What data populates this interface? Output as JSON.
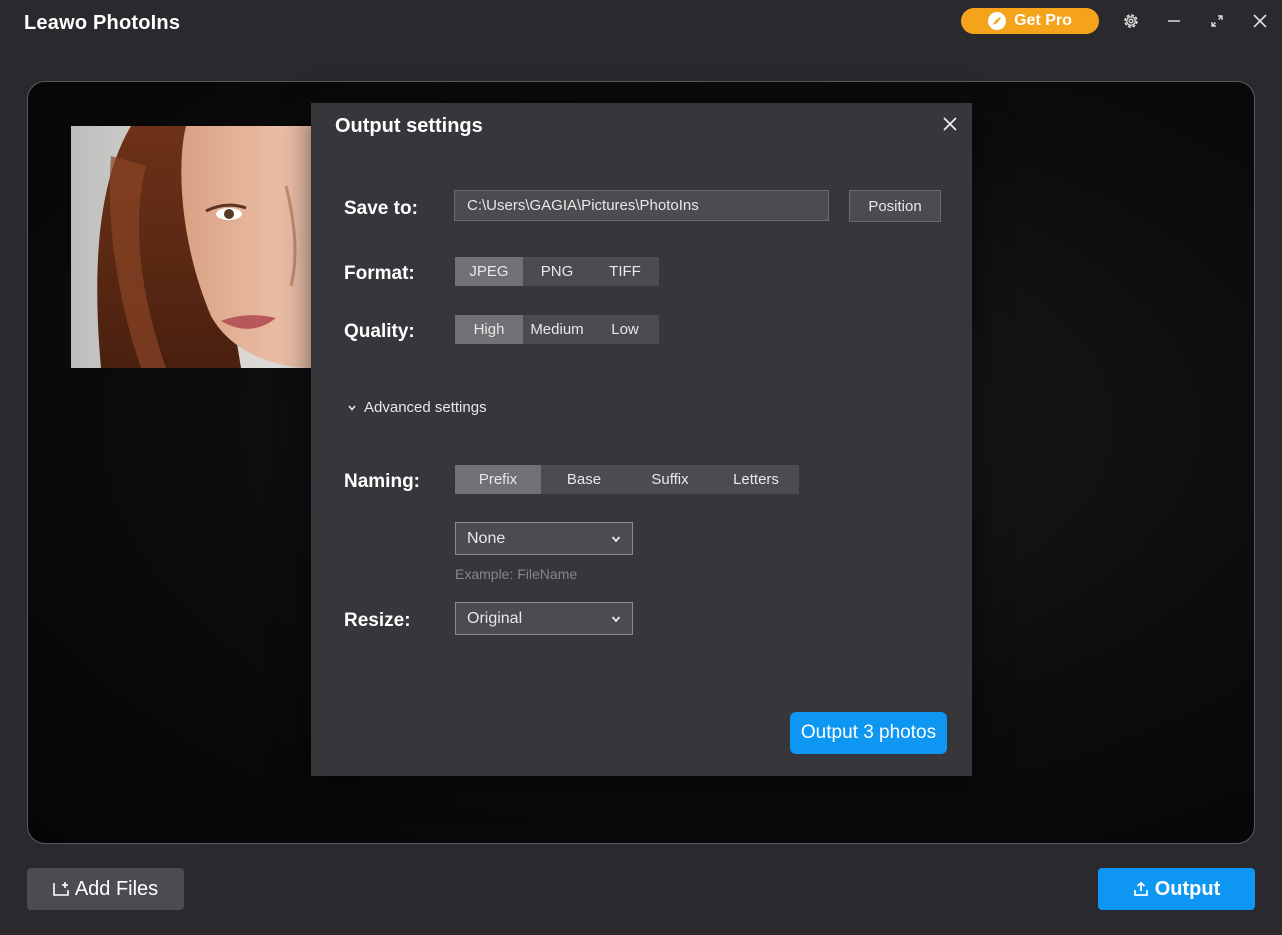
{
  "app": {
    "title": "Leawo PhotoIns",
    "get_pro_label": "Get Pro",
    "accent": "#0d96f2",
    "pro_color": "#f5a31a"
  },
  "window_controls": [
    "gear-icon",
    "minimize-icon",
    "maximize-icon",
    "close-icon"
  ],
  "modal": {
    "title": "Output settings",
    "save_to": {
      "label": "Save to:",
      "path": "C:\\Users\\GAGIA\\Pictures\\PhotoIns",
      "button": "Position"
    },
    "format": {
      "label": "Format:",
      "options": [
        "JPEG",
        "PNG",
        "TIFF"
      ],
      "selected": "JPEG"
    },
    "quality": {
      "label": "Quality:",
      "options": [
        "High",
        "Medium",
        "Low"
      ],
      "selected": "High"
    },
    "advanced_label": "Advanced settings",
    "naming": {
      "label": "Naming:",
      "options": [
        "Prefix",
        "Base",
        "Suffix",
        "Letters"
      ],
      "selected": "Prefix",
      "select_value": "None",
      "example": "Example: FileName"
    },
    "resize": {
      "label": "Resize:",
      "select_value": "Original"
    },
    "output_button": "Output 3 photos"
  },
  "footer": {
    "add_files": "Add Files",
    "output": "Output"
  }
}
